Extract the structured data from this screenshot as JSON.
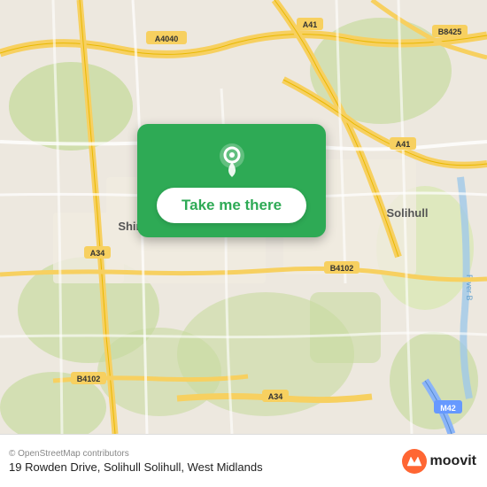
{
  "map": {
    "alt": "Map of Solihull, West Midlands area"
  },
  "button": {
    "label": "Take me there"
  },
  "bottom": {
    "copyright": "© OpenStreetMap contributors",
    "address": "19 Rowden Drive, Solihull Solihull, West Midlands"
  },
  "moovit": {
    "text": "moovit",
    "icon_char": "m"
  },
  "colors": {
    "green": "#2eaa55",
    "orange": "#ff6633"
  }
}
